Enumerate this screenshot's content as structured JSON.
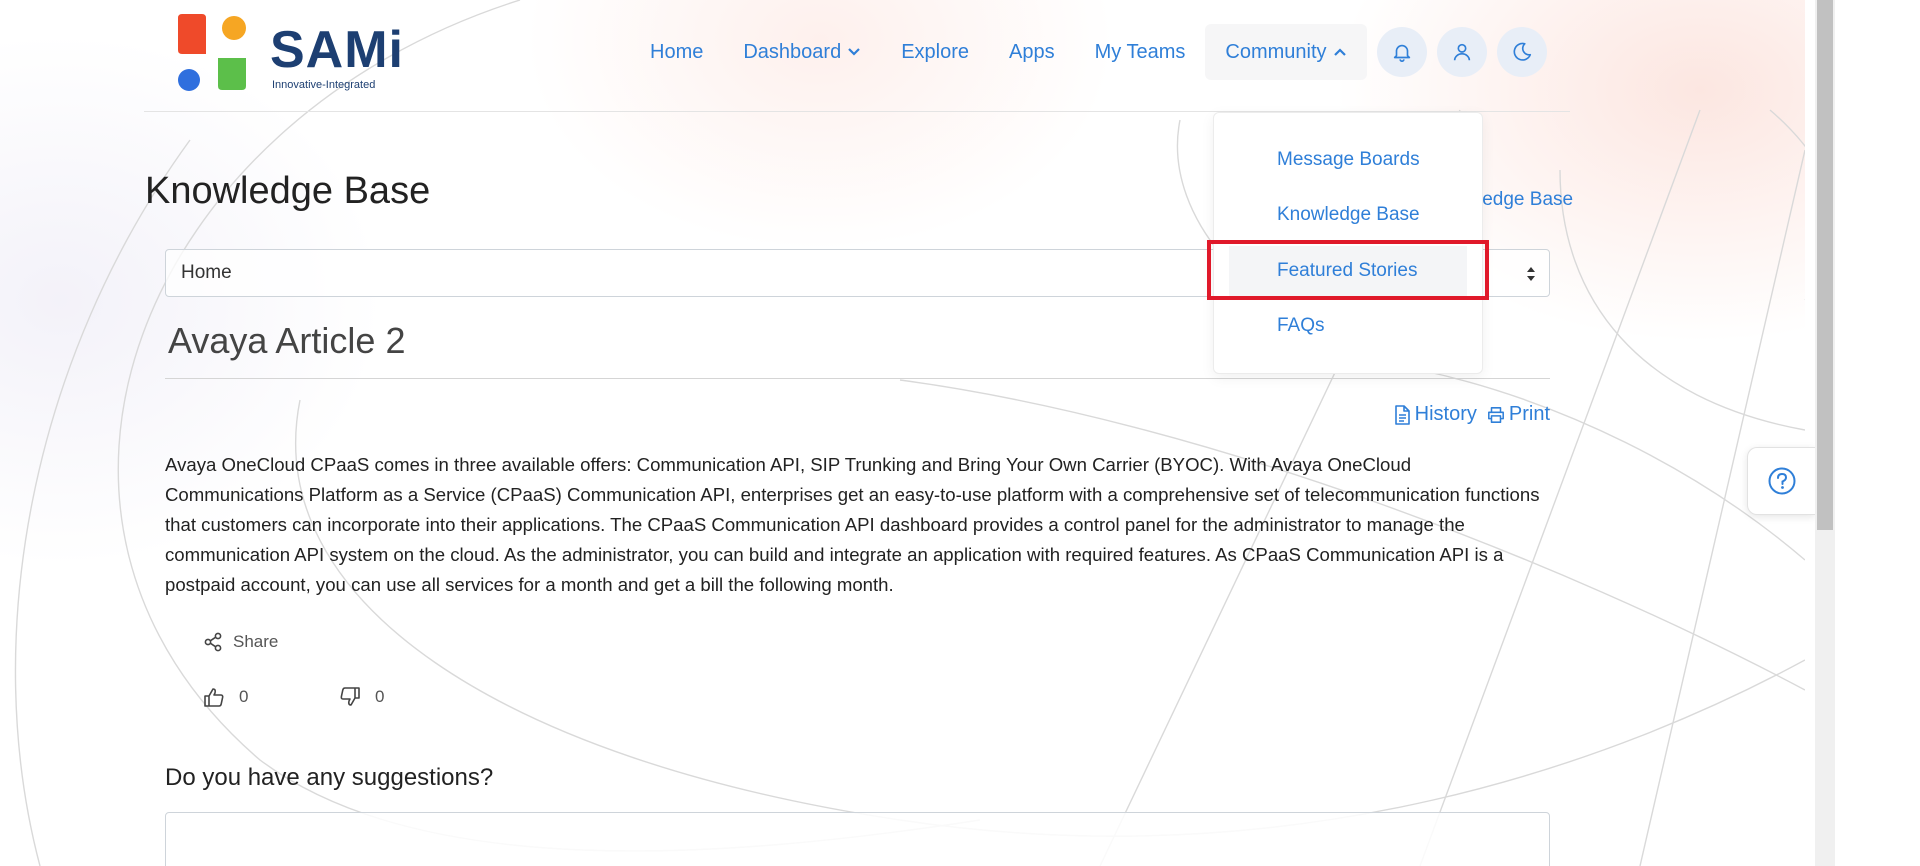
{
  "brand": {
    "name": "SAMi",
    "tagline": "Innovative-Integrated"
  },
  "nav": {
    "items": [
      {
        "label": "Home",
        "icon": ""
      },
      {
        "label": "Dashboard",
        "icon": "chevron-down-icon"
      },
      {
        "label": "Explore",
        "icon": ""
      },
      {
        "label": "Apps",
        "icon": ""
      },
      {
        "label": "My Teams",
        "icon": ""
      },
      {
        "label": "Community",
        "icon": "chevron-up-icon"
      }
    ],
    "buttons": [
      "bell-icon",
      "user-icon",
      "moon-icon"
    ]
  },
  "community_menu": {
    "items": [
      "Message Boards",
      "Knowledge Base",
      "Featured Stories",
      "FAQs"
    ],
    "hovered": "Featured Stories"
  },
  "page": {
    "title": "Knowledge Base",
    "breadcrumb_partial": "ledge Base",
    "select_value": "Home"
  },
  "article": {
    "title": "Avaya Article 2",
    "history_label": "History",
    "print_label": "Print",
    "body": "Avaya OneCloud CPaaS comes in three available offers: Communication API, SIP Trunking and Bring Your Own Carrier (BYOC). With Avaya OneCloud Communications Platform as a Service (CPaaS) Communication API, enterprises get an easy-to-use platform with a comprehensive set of telecommunication functions that customers can incorporate into their applications. The CPaaS Communication API dashboard provides a control panel for the administrator to manage the communication API system on the cloud. As the administrator, you can build and integrate an application with required features. As CPaaS Communication API is a postpaid account, you can use all services for a month and get a bill the following month.",
    "share_label": "Share",
    "likes": "0",
    "dislikes": "0"
  },
  "suggestions": {
    "title": "Do you have any suggestions?",
    "value": ""
  },
  "colors": {
    "link": "#2f7fd8",
    "brand_text": "#1d3f72",
    "highlight": "#e0192a"
  }
}
